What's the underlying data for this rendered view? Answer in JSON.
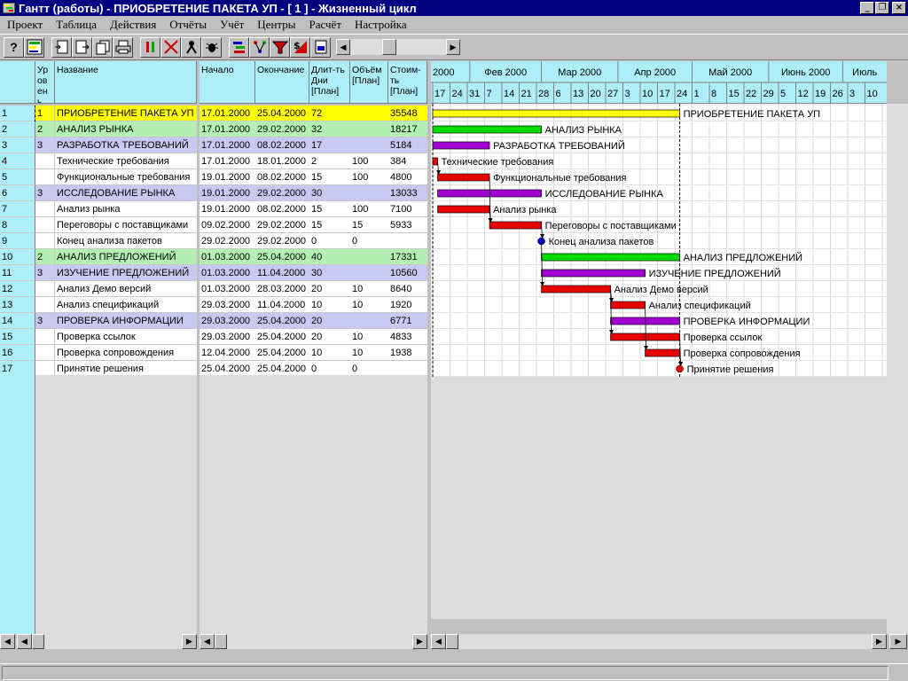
{
  "window": {
    "title": "Гантт (работы) - ПРИОБРЕТЕНИЕ ПАКЕТА УП - [ 1 ] - Жизненный цикл",
    "controls": [
      "_",
      "❐",
      "×"
    ]
  },
  "menu": [
    "Проект",
    "Таблица",
    "Действия",
    "Отчёты",
    "Учёт",
    "Центры",
    "Расчёт",
    "Настройка"
  ],
  "toolbar": {
    "help_label": "?"
  },
  "columns": {
    "level": "Ур ов ень",
    "name": "Название",
    "start": "Начало",
    "end": "Окончание",
    "duration": "Длит-ть Дни [План]",
    "volume": "Объём [План]",
    "cost": "Стоим-ть [План]"
  },
  "timeline": {
    "months": [
      "2000",
      "Фев 2000",
      "Мар 2000",
      "Апр 2000",
      "Май 2000",
      "Июнь 2000",
      "Июль"
    ],
    "days": [
      "17",
      "24",
      "31",
      "7",
      "14",
      "21",
      "28",
      "6",
      "13",
      "20",
      "27",
      "3",
      "10",
      "17",
      "24",
      "1",
      "8",
      "15",
      "22",
      "29",
      "5",
      "12",
      "19",
      "26",
      "3",
      "10"
    ]
  },
  "colors": {
    "summary_l1_bg": "#ffff00",
    "summary_l2_bg": "#b4f0b4",
    "summary_l3_bg": "#c8c8f0",
    "bar_l1": "#ffff00",
    "bar_l2": "#00dc00",
    "bar_l3": "#a000d2",
    "bar_task": "#e60000",
    "milestone_blue": "#0000c8",
    "milestone_red": "#e60000",
    "header_bg": "#aeeef8"
  },
  "tasks": [
    {
      "id": "1",
      "level": "1",
      "name": "ПРИОБРЕТЕНИЕ ПАКЕТА УП",
      "start": "17.01.2000",
      "end": "25.04.2000",
      "duration": "72",
      "volume": "",
      "cost": "35548",
      "kind": "l1"
    },
    {
      "id": "2",
      "level": "2",
      "name": "АНАЛИЗ РЫНКА",
      "start": "17.01.2000",
      "end": "29.02.2000",
      "duration": "32",
      "volume": "",
      "cost": "18217",
      "kind": "l2"
    },
    {
      "id": "3",
      "level": "3",
      "name": "РАЗРАБОТКА ТРЕБОВАНИЙ",
      "start": "17.01.2000",
      "end": "08.02.2000",
      "duration": "17",
      "volume": "",
      "cost": "5184",
      "kind": "l3"
    },
    {
      "id": "4",
      "level": "",
      "name": "Технические требования",
      "start": "17.01.2000",
      "end": "18.01.2000",
      "duration": "2",
      "volume": "100",
      "cost": "384",
      "kind": "task"
    },
    {
      "id": "5",
      "level": "",
      "name": "Функциональные требования",
      "start": "19.01.2000",
      "end": "08.02.2000",
      "duration": "15",
      "volume": "100",
      "cost": "4800",
      "kind": "task"
    },
    {
      "id": "6",
      "level": "3",
      "name": "ИССЛЕДОВАНИЕ РЫНКА",
      "start": "19.01.2000",
      "end": "29.02.2000",
      "duration": "30",
      "volume": "",
      "cost": "13033",
      "kind": "l3"
    },
    {
      "id": "7",
      "level": "",
      "name": "Анализ рынка",
      "start": "19.01.2000",
      "end": "08.02.2000",
      "duration": "15",
      "volume": "100",
      "cost": "7100",
      "kind": "task"
    },
    {
      "id": "8",
      "level": "",
      "name": "Переговоры с поставщиками",
      "start": "09.02.2000",
      "end": "29.02.2000",
      "duration": "15",
      "volume": "15",
      "cost": "5933",
      "kind": "task"
    },
    {
      "id": "9",
      "level": "",
      "name": "Конец анализа пакетов",
      "start": "29.02.2000",
      "end": "29.02.2000",
      "duration": "0",
      "volume": "0",
      "cost": "",
      "kind": "ms_blue"
    },
    {
      "id": "10",
      "level": "2",
      "name": "АНАЛИЗ ПРЕДЛОЖЕНИЙ",
      "start": "01.03.2000",
      "end": "25.04.2000",
      "duration": "40",
      "volume": "",
      "cost": "17331",
      "kind": "l2"
    },
    {
      "id": "11",
      "level": "3",
      "name": "ИЗУЧЕНИЕ ПРЕДЛОЖЕНИЙ",
      "start": "01.03.2000",
      "end": "11.04.2000",
      "duration": "30",
      "volume": "",
      "cost": "10560",
      "kind": "l3"
    },
    {
      "id": "12",
      "level": "",
      "name": "Анализ Демо версий",
      "start": "01.03.2000",
      "end": "28.03.2000",
      "duration": "20",
      "volume": "10",
      "cost": "8640",
      "kind": "task"
    },
    {
      "id": "13",
      "level": "",
      "name": "Анализ спецификаций",
      "start": "29.03.2000",
      "end": "11.04.2000",
      "duration": "10",
      "volume": "10",
      "cost": "1920",
      "kind": "task"
    },
    {
      "id": "14",
      "level": "3",
      "name": "ПРОВЕРКА ИНФОРМАЦИИ",
      "start": "29.03.2000",
      "end": "25.04.2000",
      "duration": "20",
      "volume": "",
      "cost": "6771",
      "kind": "l3"
    },
    {
      "id": "15",
      "level": "",
      "name": "Проверка ссылок",
      "start": "29.03.2000",
      "end": "25.04.2000",
      "duration": "20",
      "volume": "10",
      "cost": "4833",
      "kind": "task"
    },
    {
      "id": "16",
      "level": "",
      "name": "Проверка сопровождения",
      "start": "12.04.2000",
      "end": "25.04.2000",
      "duration": "10",
      "volume": "10",
      "cost": "1938",
      "kind": "task"
    },
    {
      "id": "17",
      "level": "",
      "name": "Принятие решения",
      "start": "25.04.2000",
      "end": "25.04.2000",
      "duration": "0",
      "volume": "0",
      "cost": "",
      "kind": "ms_red"
    }
  ]
}
